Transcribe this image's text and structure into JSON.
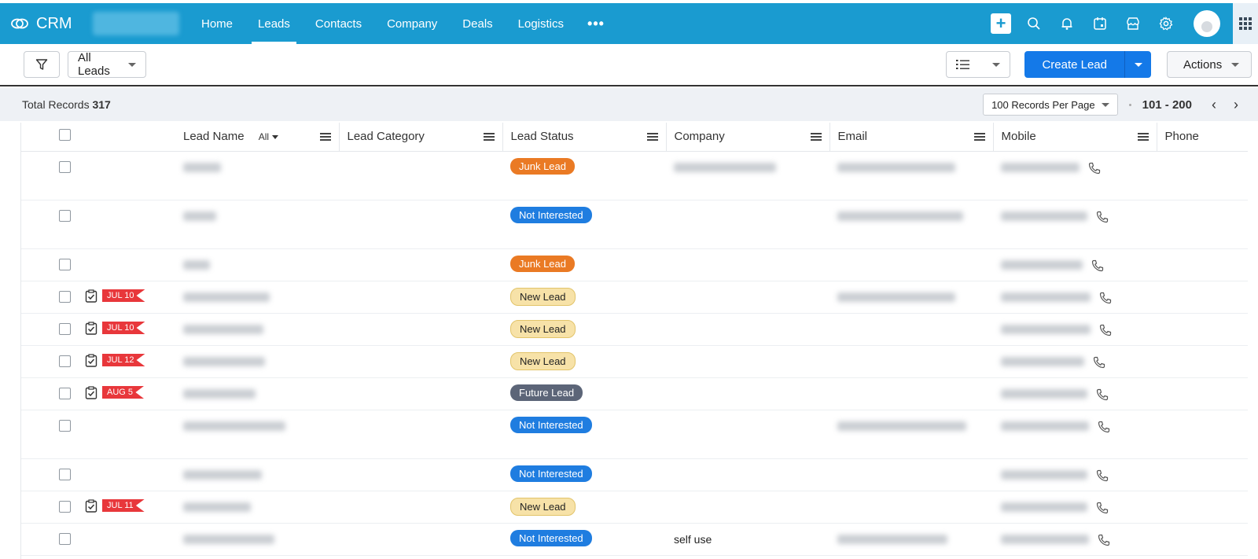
{
  "app": {
    "name": "CRM"
  },
  "nav": {
    "items": [
      "Home",
      "Leads",
      "Contacts",
      "Company",
      "Deals",
      "Logistics"
    ],
    "active": "Leads",
    "more": "•••"
  },
  "toolbar": {
    "view": "All Leads",
    "create_label": "Create Lead",
    "actions_label": "Actions"
  },
  "summary": {
    "total_label": "Total Records",
    "total_value": "317",
    "per_page": "100 Records Per Page",
    "range": "101 - 200",
    "prev": "‹",
    "next": "›"
  },
  "table": {
    "columns": {
      "lead_name": "Lead Name",
      "lead_name_filter": "All",
      "lead_category": "Lead Category",
      "lead_status": "Lead Status",
      "company": "Company",
      "email": "Email",
      "mobile": "Mobile",
      "phone": "Phone"
    },
    "rows": [
      {
        "task": "",
        "status": "Junk Lead",
        "status_color": "#ea7a24",
        "company": "",
        "tall": true
      },
      {
        "task": "",
        "status": "Not Interested",
        "status_color": "#1f7de0",
        "company": "",
        "tall": true
      },
      {
        "task": "",
        "status": "Junk Lead",
        "status_color": "#ea7a24",
        "company": "",
        "tall": false
      },
      {
        "task": "JUL 10",
        "status": "New Lead",
        "status_color": "#f7e2a8",
        "company": "",
        "tall": false
      },
      {
        "task": "JUL 10",
        "status": "New Lead",
        "status_color": "#f7e2a8",
        "company": "",
        "tall": false
      },
      {
        "task": "JUL 12",
        "status": "New Lead",
        "status_color": "#f7e2a8",
        "company": "",
        "tall": false
      },
      {
        "task": "AUG 5",
        "status": "Future Lead",
        "status_color": "#5c6578",
        "company": "",
        "tall": false
      },
      {
        "task": "",
        "status": "Not Interested",
        "status_color": "#1f7de0",
        "company": "",
        "tall": true
      },
      {
        "task": "",
        "status": "Not Interested",
        "status_color": "#1f7de0",
        "company": "",
        "tall": false
      },
      {
        "task": "JUL 11",
        "status": "New Lead",
        "status_color": "#f7e2a8",
        "company": "",
        "tall": false
      },
      {
        "task": "",
        "status": "Not Interested",
        "status_color": "#1f7de0",
        "company": "self use",
        "tall": false
      }
    ]
  },
  "colors": {
    "topbar": "#1a9bd0",
    "primary_button": "#1479e8",
    "task_flag": "#e8373b"
  }
}
